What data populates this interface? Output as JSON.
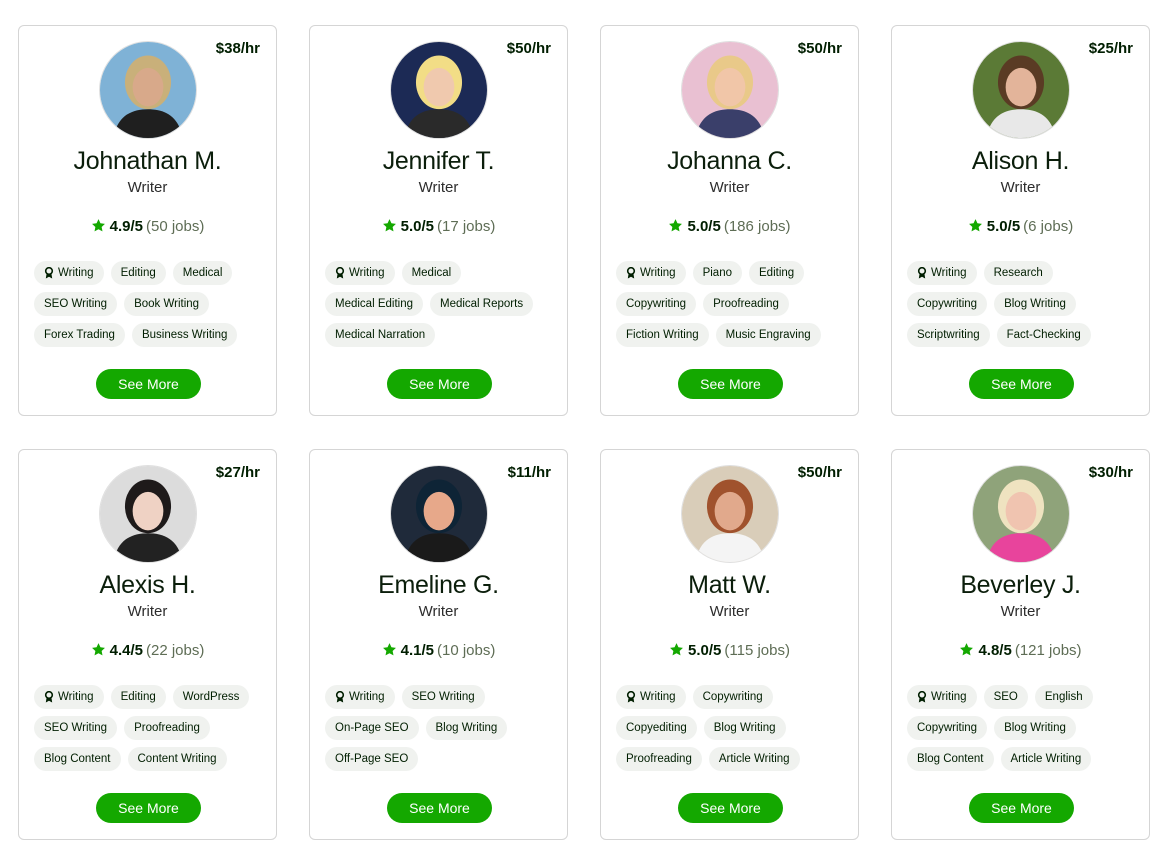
{
  "cards": [
    {
      "rate": "$38/hr",
      "name": "Johnathan M.",
      "role": "Writer",
      "score": "4.9/5",
      "jobs": "(50 jobs)",
      "skills": [
        "Writing",
        "Editing",
        "Medical",
        "SEO Writing",
        "Book Writing",
        "Forex Trading",
        "Business Writing"
      ],
      "button": "See More"
    },
    {
      "rate": "$50/hr",
      "name": "Jennifer T.",
      "role": "Writer",
      "score": "5.0/5",
      "jobs": "(17 jobs)",
      "skills": [
        "Writing",
        "Medical",
        "Medical Editing",
        "Medical Reports",
        "Medical Narration"
      ],
      "button": "See More"
    },
    {
      "rate": "$50/hr",
      "name": "Johanna C.",
      "role": "Writer",
      "score": "5.0/5",
      "jobs": "(186 jobs)",
      "skills": [
        "Writing",
        "Piano",
        "Editing",
        "Copywriting",
        "Proofreading",
        "Fiction Writing",
        "Music Engraving"
      ],
      "button": "See More"
    },
    {
      "rate": "$25/hr",
      "name": "Alison H.",
      "role": "Writer",
      "score": "5.0/5",
      "jobs": "(6 jobs)",
      "skills": [
        "Writing",
        "Research",
        "Copywriting",
        "Blog Writing",
        "Scriptwriting",
        "Fact-Checking"
      ],
      "button": "See More"
    },
    {
      "rate": "$27/hr",
      "name": "Alexis H.",
      "role": "Writer",
      "score": "4.4/5",
      "jobs": "(22 jobs)",
      "skills": [
        "Writing",
        "Editing",
        "WordPress",
        "SEO Writing",
        "Proofreading",
        "Blog Content",
        "Content Writing"
      ],
      "button": "See More"
    },
    {
      "rate": "$11/hr",
      "name": "Emeline G.",
      "role": "Writer",
      "score": "4.1/5",
      "jobs": "(10 jobs)",
      "skills": [
        "Writing",
        "SEO Writing",
        "On-Page SEO",
        "Blog Writing",
        "Off-Page SEO"
      ],
      "button": "See More"
    },
    {
      "rate": "$50/hr",
      "name": "Matt W.",
      "role": "Writer",
      "score": "5.0/5",
      "jobs": "(115 jobs)",
      "skills": [
        "Writing",
        "Copywriting",
        "Copyediting",
        "Blog Writing",
        "Proofreading",
        "Article Writing"
      ],
      "button": "See More"
    },
    {
      "rate": "$30/hr",
      "name": "Beverley J.",
      "role": "Writer",
      "score": "4.8/5",
      "jobs": "(121 jobs)",
      "skills": [
        "Writing",
        "SEO",
        "English",
        "Copywriting",
        "Blog Writing",
        "Blog Content",
        "Article Writing"
      ],
      "button": "See More"
    }
  ],
  "colors": {
    "accent": "#14a800",
    "star": "#14a800",
    "chip": "#f0f2ef",
    "border": "#d5d5d5"
  },
  "avatar_palettes": [
    {
      "bg": "#7fb2d6",
      "skin": "#d8a98a",
      "hair": "#c9b07a",
      "shirt": "#1f1f1f"
    },
    {
      "bg": "#1c2a55",
      "skin": "#f0c9ae",
      "hair": "#f2dd86",
      "shirt": "#2a2a2a"
    },
    {
      "bg": "#e9c0d2",
      "skin": "#f1c6a8",
      "hair": "#e9c989",
      "shirt": "#3a3f6a"
    },
    {
      "bg": "#5b7a36",
      "skin": "#e3b49a",
      "hair": "#5a3b24",
      "shirt": "#e8e8e8"
    },
    {
      "bg": "#dcdcdc",
      "skin": "#efd2c4",
      "hair": "#1e1a1a",
      "shirt": "#222222"
    },
    {
      "bg": "#1f2a3a",
      "skin": "#e7a88a",
      "hair": "#0e2436",
      "shirt": "#1a1a1a"
    },
    {
      "bg": "#d9cdb9",
      "skin": "#e1a98c",
      "hair": "#a0522d",
      "shirt": "#f4f4f4"
    },
    {
      "bg": "#8fa37a",
      "skin": "#f0c4b0",
      "hair": "#efe3c0",
      "shirt": "#e8449c"
    }
  ]
}
